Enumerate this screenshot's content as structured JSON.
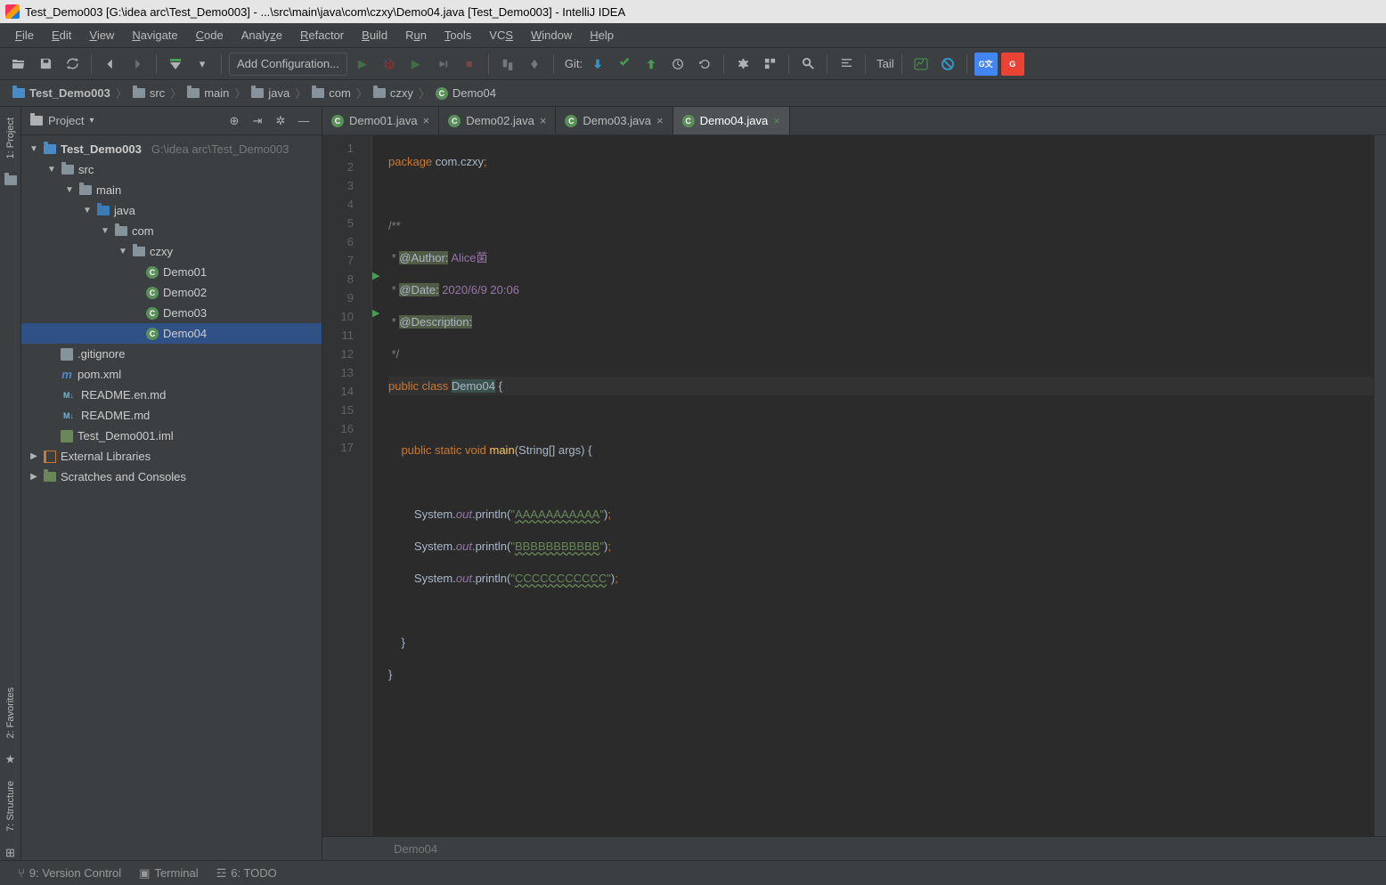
{
  "window": {
    "title": "Test_Demo003 [G:\\idea arc\\Test_Demo003] - ...\\src\\main\\java\\com\\czxy\\Demo04.java [Test_Demo003] - IntelliJ IDEA"
  },
  "menubar": [
    "File",
    "Edit",
    "View",
    "Navigate",
    "Code",
    "Analyze",
    "Refactor",
    "Build",
    "Run",
    "Tools",
    "VCS",
    "Window",
    "Help"
  ],
  "toolbar": {
    "config": "Add Configuration...",
    "git_label": "Git:",
    "tail": "Tail"
  },
  "breadcrumb": [
    "Test_Demo003",
    "src",
    "main",
    "java",
    "com",
    "czxy",
    "Demo04"
  ],
  "project": {
    "title": "Project",
    "tree": {
      "root": "Test_Demo003",
      "root_hint": "G:\\idea arc\\Test_Demo003",
      "src": "src",
      "main": "main",
      "java": "java",
      "com": "com",
      "czxy": "czxy",
      "demo01": "Demo01",
      "demo02": "Demo02",
      "demo03": "Demo03",
      "demo04": "Demo04",
      "gitignore": ".gitignore",
      "pom": "pom.xml",
      "readme_en": "README.en.md",
      "readme": "README.md",
      "iml": "Test_Demo001.iml",
      "ext_lib": "External Libraries",
      "scratch": "Scratches and Consoles"
    }
  },
  "tabs": [
    {
      "label": "Demo01.java",
      "active": false
    },
    {
      "label": "Demo02.java",
      "active": false
    },
    {
      "label": "Demo03.java",
      "active": false
    },
    {
      "label": "Demo04.java",
      "active": true
    }
  ],
  "code": {
    "package_kw": "package",
    "package_name": " com.czxy",
    "doc_open": "/**",
    "doc_star": " * ",
    "doc_close": " */",
    "author_tag": "@Author:",
    "author_val": " Alice菌",
    "date_tag": "@Date:",
    "date_val": " 2020/6/9 20:06",
    "desc_tag": "@Description:",
    "public": "public",
    "class": "class",
    "classname": "Demo04",
    "static": "static",
    "void": "void",
    "main": "main",
    "string": "String",
    "args": "args",
    "system": "System.",
    "out": "out",
    "println": ".println",
    "str_a": "AAAAAAAAAAA",
    "str_b": "BBBBBBBBBBB",
    "str_c": "CCCCCCCCCCC",
    "semicolon": ";",
    "brace_open": " {",
    "paren_open": "(",
    "paren_close": ") {"
  },
  "editor_crumb": "Demo04",
  "bottombar": {
    "vc": "9: Version Control",
    "terminal": "Terminal",
    "todo": "6: TODO"
  }
}
